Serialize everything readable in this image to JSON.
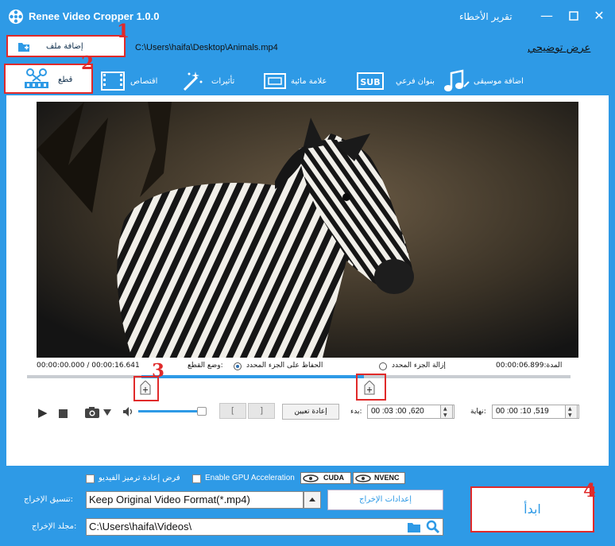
{
  "window": {
    "title": "Renee Video Cropper 1.0.0",
    "report_errors": "تقرير الأخطاء",
    "minimize_glyph": "—",
    "close_glyph": "✕"
  },
  "toolbar": {
    "add_file_label": "إضافة ملف",
    "file_path": "C:\\Users\\haifa\\Desktop\\Animals.mp4",
    "show_tutorial": "عرض توضيحي"
  },
  "tabs": [
    {
      "label": "قطع"
    },
    {
      "label": "اقتصاص"
    },
    {
      "label": "تأثيرات"
    },
    {
      "label": "علامة مائية"
    },
    {
      "label": "بنوان فرعي"
    },
    {
      "label": "اضافة موسيقى"
    }
  ],
  "timeline": {
    "current_time": "00:00:00.000 / 00:00:16.641",
    "cut_mode_label": "وضع القطع:",
    "keep_selected": "الحفاظ على الجزء المحدد",
    "remove_selected": "إزالة الجزء المحدد",
    "duration": "المدة:00:00:06.899",
    "selection_start": 0.21,
    "selection_end": 0.62
  },
  "controls": {
    "play_glyph": "▶",
    "volume_level": 0.95,
    "seg_start_glyph": "[",
    "seg_end_glyph": "]",
    "reset_label": "إعادة تعيين",
    "start_label": "بدء:",
    "start_value": "00 :03 :00 ,620",
    "end_label": "نهاية:",
    "end_value": "00 :00 :10 ,519"
  },
  "bottom": {
    "force_reencode": "فرض إعادة ترميز الفيديو",
    "gpu_accel": "Enable GPU Acceleration",
    "cuda": "CUDA",
    "nvenc": "NVENC",
    "format_label": "تنسيق الإخراج:",
    "format_value": "Keep Original Video Format(*.mp4)",
    "output_settings": "إعدادات الإخراج",
    "folder_label": "مجلد الإخراج:",
    "folder_value": "C:\\Users\\haifa\\Videos\\",
    "start_button": "ابدأ"
  },
  "annotations": [
    "1",
    "2",
    "3",
    "4"
  ],
  "colors": {
    "accent": "#2e9ae6",
    "highlight": "#e02a2a"
  }
}
